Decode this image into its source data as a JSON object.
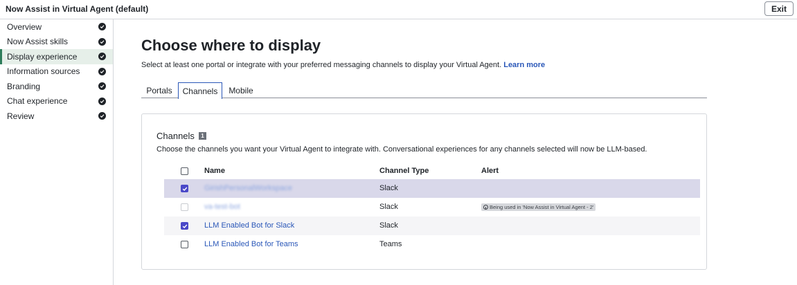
{
  "app": {
    "title": "Now Assist in Virtual Agent (default)",
    "exit_label": "Exit"
  },
  "sidebar": {
    "items": [
      {
        "label": "Overview",
        "status": "complete"
      },
      {
        "label": "Now Assist skills",
        "status": "complete"
      },
      {
        "label": "Display experience",
        "status": "complete",
        "active": true
      },
      {
        "label": "Information sources",
        "status": "complete"
      },
      {
        "label": "Branding",
        "status": "complete"
      },
      {
        "label": "Chat experience",
        "status": "complete"
      },
      {
        "label": "Review",
        "status": "complete"
      }
    ]
  },
  "main": {
    "title": "Choose where to display",
    "subtitle": "Select at least one portal or integrate with your preferred messaging channels to display your Virtual Agent.",
    "learn_more": "Learn more",
    "tabs": [
      {
        "label": "Portals"
      },
      {
        "label": "Channels",
        "active": true
      },
      {
        "label": "Mobile"
      }
    ]
  },
  "channels": {
    "title": "Channels",
    "count": "1",
    "description": "Choose the channels you want your Virtual Agent to integrate with. Conversational experiences for any channels selected will now be LLM-based.",
    "columns": {
      "name": "Name",
      "type": "Channel Type",
      "alert": "Alert"
    },
    "rows": [
      {
        "name": "GirishPersonalWorkspace",
        "type": "Slack",
        "alert": "",
        "checked": true,
        "disabled": false,
        "blurred": true
      },
      {
        "name": "va-test-bot",
        "type": "Slack",
        "alert": "Being used in 'Now Assist in Virtual Agent - 2'",
        "checked": false,
        "disabled": true,
        "blurred": true
      },
      {
        "name": "LLM Enabled Bot for Slack",
        "type": "Slack",
        "alert": "",
        "checked": true,
        "disabled": false,
        "blurred": false
      },
      {
        "name": "LLM Enabled Bot for Teams",
        "type": "Teams",
        "alert": "",
        "checked": false,
        "disabled": false,
        "blurred": false
      }
    ]
  },
  "colors": {
    "accent": "#2a57b8",
    "checkbox": "#4a48c8",
    "selected_row": "#d9d8ea",
    "active_nav": "#2e7d5b"
  }
}
